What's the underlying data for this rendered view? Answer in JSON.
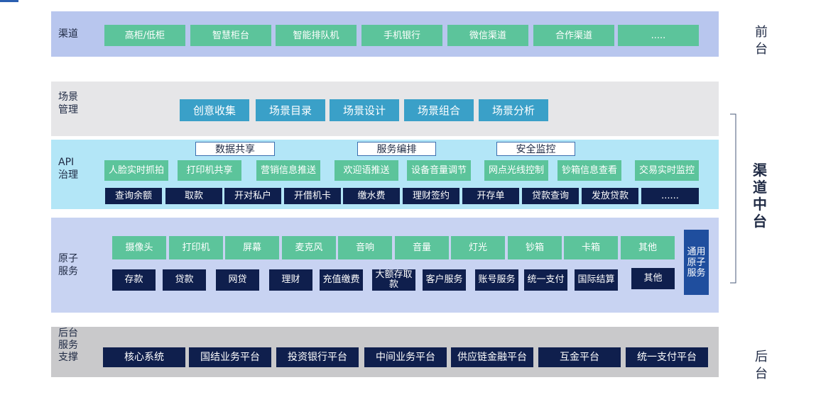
{
  "channel": {
    "label": "渠道",
    "items": [
      "高柜/低柜",
      "智慧柜台",
      "智能排队机",
      "手机银行",
      "微信渠道",
      "合作渠道",
      "....."
    ]
  },
  "scene": {
    "label": "场景\n管理",
    "items": [
      "创意收集",
      "场景目录",
      "场景设计",
      "场景组合",
      "场景分析"
    ]
  },
  "api": {
    "label": "API\n治理",
    "headers": [
      "数据共享",
      "服务编排",
      "安全监控"
    ],
    "green_items": [
      "人脸实时抓拍",
      "打印机共享",
      "营销信息推送",
      "欢迎语推送",
      "设备音量调节",
      "网点光线控制",
      "钞箱信息查看",
      "交易实时监控"
    ],
    "navy_items": [
      "查询余额",
      "取款",
      "开对私户",
      "开借机卡",
      "缴水费",
      "理财签约",
      "开存单",
      "贷款查询",
      "发放贷款",
      "......"
    ]
  },
  "atomic": {
    "label": "原子\n服务",
    "green_items": [
      "摄像头",
      "打印机",
      "屏幕",
      "麦克风",
      "音响",
      "音量",
      "灯光",
      "钞箱",
      "卡箱",
      "其他"
    ],
    "navy_items": [
      "存款",
      "贷款",
      "网贷",
      "理财",
      "充值缴费",
      "大额存取款",
      "客户服务",
      "账号服务",
      "统一支付",
      "国际结算",
      "其他"
    ],
    "common": "通用原子服务"
  },
  "backend": {
    "label": "后台\n服务\n支撑",
    "items": [
      "核心系统",
      "国结业务平台",
      "投资银行平台",
      "中间业务平台",
      "供应链金融平台",
      "互金平台",
      "统一支付平台"
    ]
  },
  "side_labels": {
    "front": "前台",
    "middle": "渠道中台",
    "back": "后台"
  }
}
